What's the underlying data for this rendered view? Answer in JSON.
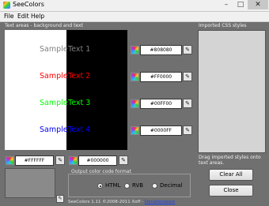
{
  "window": {
    "title": "SeeColors",
    "min_glyph": "–",
    "max_glyph": "□",
    "close_glyph": "✕"
  },
  "menu": {
    "items": [
      "File",
      "Edit",
      "Help"
    ]
  },
  "text_areas_label": "Text areas - background and text",
  "samples": [
    {
      "left": "Sample",
      "right": "Text 1",
      "left_color": "#808080",
      "right_color": "#808080",
      "value": "#808080"
    },
    {
      "left": "Sample",
      "right": "Text 2",
      "left_color": "#FF0000",
      "right_color": "#FF0000",
      "value": "#FF0000"
    },
    {
      "left": "Sample",
      "right": "Text 3",
      "left_color": "#00FF00",
      "right_color": "#00FF00",
      "value": "#00FF00"
    },
    {
      "left": "Sample",
      "right": "Text 4",
      "left_color": "#0000FF",
      "right_color": "#0000FF",
      "value": "#0000FF"
    }
  ],
  "background_white": {
    "value": "#FFFFFF"
  },
  "background_black": {
    "value": "#000000"
  },
  "imported_css_label": "Imported CSS styles",
  "drag_hint_line1": "Drag imported styles onto",
  "drag_hint_line2": "text areas.",
  "output_format": {
    "label": "Output color code format",
    "options": [
      "HTML",
      "RVB",
      "Decimal"
    ],
    "selected": "HTML"
  },
  "buttons": {
    "clear_all": "Clear All",
    "close": "Close"
  },
  "footer": {
    "text": "SeeColors 1.11 ©2008-2011 Xoff - ",
    "link": "Donationware"
  },
  "colors": {
    "window_bg": "#707070",
    "link": "#2244EE"
  }
}
